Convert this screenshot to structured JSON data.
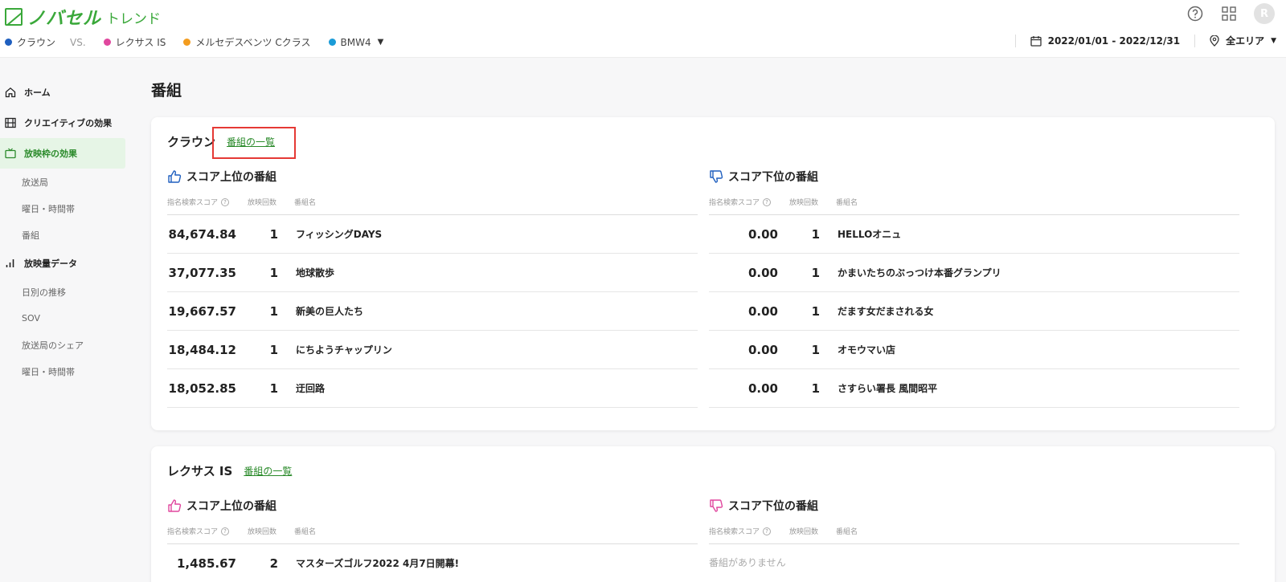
{
  "header": {
    "logo_main": "ノバセル",
    "logo_sub": "トレンド",
    "avatar_initial": "R"
  },
  "compare": {
    "items": [
      {
        "label": "クラウン",
        "color": "#1f5fbf"
      },
      {
        "label": "レクサス IS",
        "color": "#e0479e"
      },
      {
        "label": "メルセデスベンツ Cクラス",
        "color": "#f39c1f"
      },
      {
        "label": "BMW4",
        "color": "#1a9bd7"
      }
    ],
    "vs_label": "VS."
  },
  "filters": {
    "date_range": "2022/01/01 - 2022/12/31",
    "area": "全エリア"
  },
  "sidebar": {
    "home": "ホーム",
    "creative": "クリエイティブの効果",
    "slot": "放映枠の効果",
    "slot_sub": [
      "放送局",
      "曜日・時間帯",
      "番組"
    ],
    "volume": "放映量データ",
    "volume_sub": [
      "日別の推移",
      "SOV",
      "放送局のシェア",
      "曜日・時間帯"
    ]
  },
  "page_title": "番組",
  "table_headers": {
    "score": "指名検索スコア",
    "count": "放映回数",
    "name": "番組名",
    "top_title": "スコア上位の番組",
    "bottom_title": "スコア下位の番組",
    "list_link": "番組の一覧",
    "empty": "番組がありません"
  },
  "cards": [
    {
      "brand": "クラウン",
      "top": [
        {
          "score": "84,674.84",
          "count": "1",
          "name": "フィッシングDAYS"
        },
        {
          "score": "37,077.35",
          "count": "1",
          "name": "地球散歩"
        },
        {
          "score": "19,667.57",
          "count": "1",
          "name": "新美の巨人たち"
        },
        {
          "score": "18,484.12",
          "count": "1",
          "name": "にちようチャップリン"
        },
        {
          "score": "18,052.85",
          "count": "1",
          "name": "迂回路"
        }
      ],
      "bottom": [
        {
          "score": "0.00",
          "count": "1",
          "name": "HELLOオニュ"
        },
        {
          "score": "0.00",
          "count": "1",
          "name": "かまいたちのぶっつけ本番グランプリ"
        },
        {
          "score": "0.00",
          "count": "1",
          "name": "だます女だまされる女"
        },
        {
          "score": "0.00",
          "count": "1",
          "name": "オモウマい店"
        },
        {
          "score": "0.00",
          "count": "1",
          "name": "さすらい署長 風間昭平"
        }
      ]
    },
    {
      "brand": "レクサス IS",
      "top": [
        {
          "score": "1,485.67",
          "count": "2",
          "name": "マスターズゴルフ2022 4月7日開幕!"
        }
      ]
    }
  ],
  "colors": {
    "accent_green": "#3aa83a",
    "thumb_blue": "#1f5fbf",
    "thumb_pink": "#e0479e",
    "highlight_red": "#e53935"
  }
}
